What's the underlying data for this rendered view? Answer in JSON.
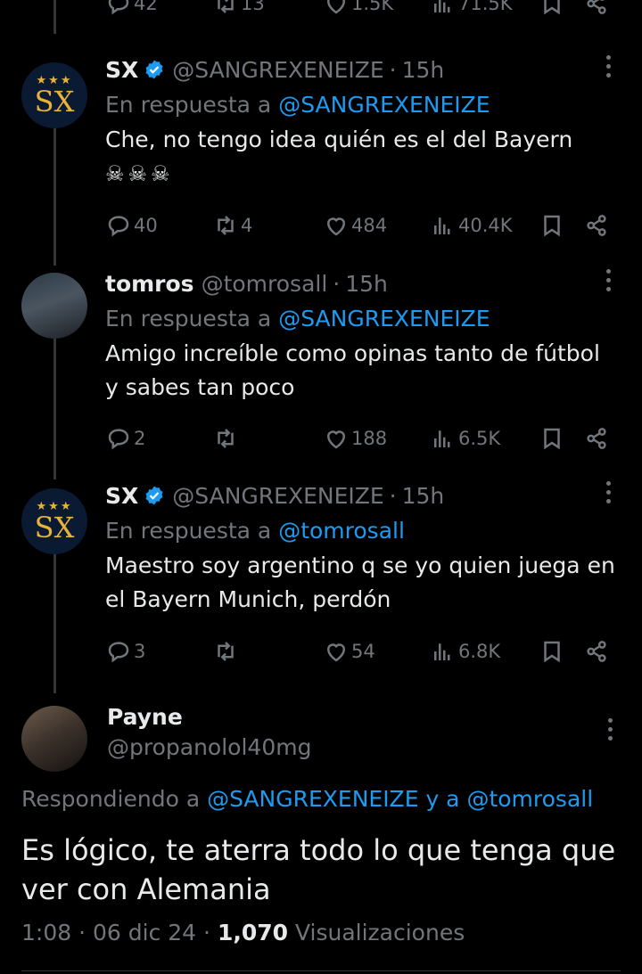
{
  "top_actions": {
    "replies": "42",
    "retweets": "13",
    "likes": "1.5K",
    "views": "71.5K"
  },
  "tweets": [
    {
      "name": "SX",
      "verified": true,
      "handle": "@SANGREXENEIZE",
      "time": "15h",
      "reply_prefix": "En respuesta a",
      "reply_to": "@SANGREXENEIZE",
      "text_line1": "Che, no tengo idea quién es el del Bayern",
      "text_line2": "☠☠☠",
      "replies": "40",
      "retweets": "4",
      "likes": "484",
      "views": "40.4K",
      "avatar": {
        "stars": "★★★",
        "monogram": "SX"
      }
    },
    {
      "name": "tomros",
      "verified": false,
      "handle": "@tomrosall",
      "time": "15h",
      "reply_prefix": "En respuesta a",
      "reply_to": "@SANGREXENEIZE",
      "text_line1": "Amigo increíble como opinas tanto de fútbol",
      "text_line2": "y sabes tan poco",
      "replies": "2",
      "retweets": "",
      "likes": "188",
      "views": "6.5K"
    },
    {
      "name": "SX",
      "verified": true,
      "handle": "@SANGREXENEIZE",
      "time": "15h",
      "reply_prefix": "En respuesta a",
      "reply_to": "@tomrosall",
      "text_line1": "Maestro soy argentino q se yo quien juega en",
      "text_line2": "el Bayern Munich, perdón",
      "replies": "3",
      "retweets": "",
      "likes": "54",
      "views": "6.8K",
      "avatar": {
        "stars": "★★★",
        "monogram": "SX"
      }
    }
  ],
  "main": {
    "name": "Payne",
    "handle": "@propanolol40mg",
    "responding_prefix": "Respondiendo a",
    "responding_to_1": "@SANGREXENEIZE",
    "responding_joiner": "y a",
    "responding_to_2": "@tomrosall",
    "text": "Es lógico, te aterra todo lo que tenga que ver con Alemania",
    "time": "1:08",
    "date": "06 dic 24",
    "views_count": "1,070",
    "views_label": "Visualizaciones"
  },
  "colors": {
    "accent": "#1d9bf0",
    "muted": "#71767b",
    "text": "#e7e9ea",
    "background": "#000000",
    "gold": "#e8b339"
  },
  "icons": [
    "reply-icon",
    "retweet-icon",
    "like-icon",
    "views-icon",
    "bookmark-icon",
    "share-icon",
    "verified-icon",
    "more-icon"
  ]
}
